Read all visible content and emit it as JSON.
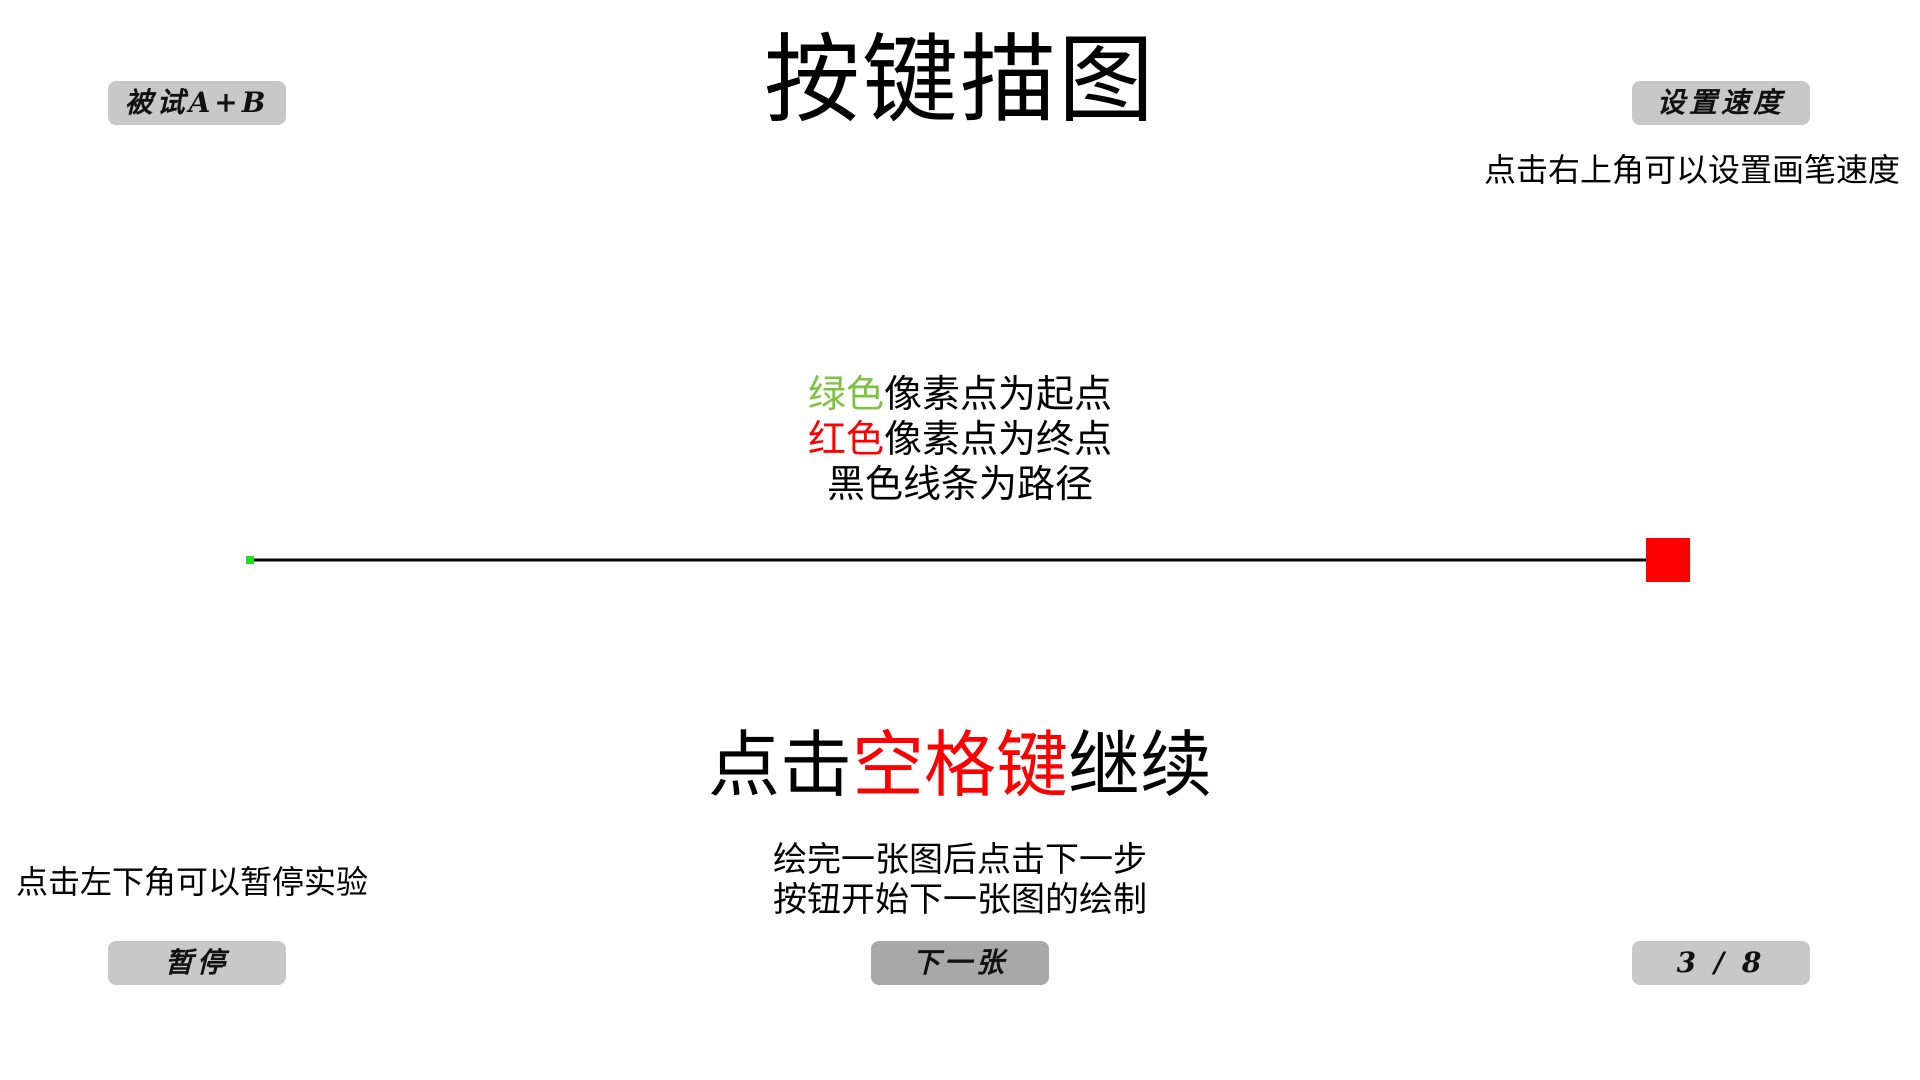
{
  "app": {
    "title": "按键描图"
  },
  "top_left_button": {
    "label": "被试A+B"
  },
  "top_right_button": {
    "label": "设置速度"
  },
  "top_right_hint": "点击右上角可以设置画笔速度",
  "legend": {
    "start_color_word": "绿色",
    "start_rest": "像素点为起点",
    "end_color_word": "红色",
    "end_rest": "像素点为终点",
    "path_line": "黑色线条为路径"
  },
  "prompt": {
    "prefix": "点击",
    "highlight": "空格键",
    "suffix": "继续"
  },
  "bottom_left_hint": "点击左下角可以暂停实验",
  "next_hint": {
    "line1": "绘完一张图后点击下一步",
    "line2": "按钮开始下一张图的绘制"
  },
  "bottom_buttons": {
    "pause_label": "暂停",
    "next_label": "下一张",
    "progress_label": "3 / 8"
  },
  "colors": {
    "start_green": "#7dc242",
    "start_pixel": "#22dd22",
    "end_red": "#ff0000",
    "path_black": "#000000",
    "button_gray": "#c8c8c8",
    "button_dark_gray": "#a8a8a8"
  }
}
